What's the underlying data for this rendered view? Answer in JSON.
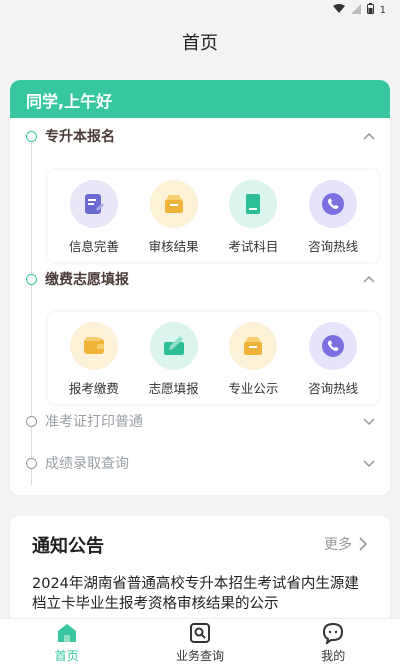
{
  "status_bar": {
    "battery": "1"
  },
  "header": {
    "title": "首页"
  },
  "greeting": "同学,上午好",
  "sections": [
    {
      "title": "专升本报名",
      "items": [
        {
          "label": "信息完善",
          "icon": "edit-icon",
          "bg": "#e8e6f7",
          "fg": "#6b6ad0"
        },
        {
          "label": "审核结果",
          "icon": "box-icon",
          "bg": "#fdf2d8",
          "fg": "#f0b33a"
        },
        {
          "label": "考试科目",
          "icon": "book-icon",
          "bg": "#dcf4ee",
          "fg": "#2dbe98"
        },
        {
          "label": "咨询热线",
          "icon": "phone-icon",
          "bg": "#e5e4fb",
          "fg": "#7c6fe0"
        }
      ]
    },
    {
      "title": "缴费志愿填报",
      "items": [
        {
          "label": "报考缴费",
          "icon": "wallet-icon",
          "bg": "#fdf2d8",
          "fg": "#f0b33a"
        },
        {
          "label": "志愿填报",
          "icon": "form-icon",
          "bg": "#dcf4ee",
          "fg": "#2dbe98"
        },
        {
          "label": "专业公示",
          "icon": "box-icon",
          "bg": "#fdf2d8",
          "fg": "#f0b33a"
        },
        {
          "label": "咨询热线",
          "icon": "phone-icon",
          "bg": "#e5e4fb",
          "fg": "#7c6fe0"
        }
      ]
    }
  ],
  "collapsed_sections": [
    {
      "title": "准考证打印普通"
    },
    {
      "title": "成绩录取查询"
    }
  ],
  "notice": {
    "title": "通知公告",
    "more": "更多",
    "text": "2024年湖南省普通高校专升本招生考试省内生源建档立卡毕业生报考资格审核结果的公示"
  },
  "tabs": [
    {
      "label": "首页",
      "icon": "home-icon",
      "active": true
    },
    {
      "label": "业务查询",
      "icon": "search-icon",
      "active": false
    },
    {
      "label": "我的",
      "icon": "chat-icon",
      "active": false
    }
  ],
  "colors": {
    "accent": "#37c7a0",
    "section_title": "#4a3b38"
  }
}
